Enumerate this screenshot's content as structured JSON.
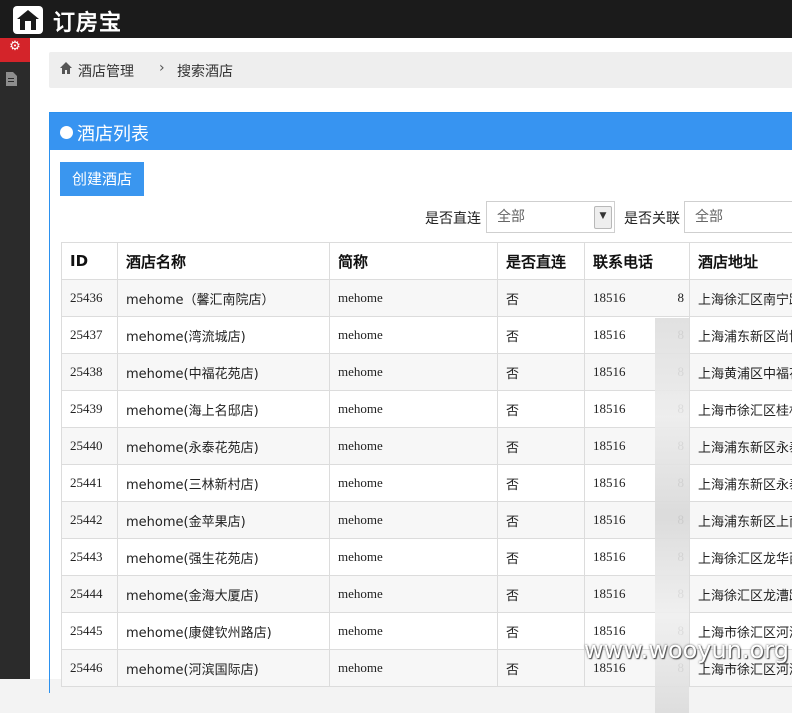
{
  "app": {
    "logo_text": "订房宝"
  },
  "breadcrumb": {
    "home": "酒店管理",
    "separator": "›",
    "current": "搜索酒店"
  },
  "panel": {
    "title": "酒店列表"
  },
  "toolbar": {
    "create_label": "创建酒店"
  },
  "filters": {
    "direct_label": "是否直连",
    "direct_value": "全部",
    "linked_label": "是否关联",
    "linked_value": "全部"
  },
  "table": {
    "headers": [
      "ID",
      "酒店名称",
      "简称",
      "是否直连",
      "联系电话",
      "酒店地址"
    ],
    "rows": [
      [
        "25436",
        "mehome（馨汇南院店）",
        "mehome",
        "否",
        "18516",
        "8",
        "上海徐汇区南宁路"
      ],
      [
        "25437",
        "mehome(湾流城店)",
        "mehome",
        "否",
        "18516",
        "8",
        "上海浦东新区尚博"
      ],
      [
        "25438",
        "mehome(中福花苑店)",
        "mehome",
        "否",
        "18516",
        "8",
        "上海黄浦区中福花"
      ],
      [
        "25439",
        "mehome(海上名邸店)",
        "mehome",
        "否",
        "18516",
        "8",
        "上海市徐汇区桂林"
      ],
      [
        "25440",
        "mehome(永泰花苑店)",
        "mehome",
        "否",
        "18516",
        "8",
        "上海浦东新区永泰"
      ],
      [
        "25441",
        "mehome(三林新村店)",
        "mehome",
        "否",
        "18516",
        "8",
        "上海浦东新区永泰"
      ],
      [
        "25442",
        "mehome(金苹果店)",
        "mehome",
        "否",
        "18516",
        "8",
        "上海浦东新区上南"
      ],
      [
        "25443",
        "mehome(强生花苑店)",
        "mehome",
        "否",
        "18516",
        "8",
        "上海徐汇区龙华西"
      ],
      [
        "25444",
        "mehome(金海大厦店)",
        "mehome",
        "否",
        "18516",
        "8",
        "上海徐汇区龙漕路"
      ],
      [
        "25445",
        "mehome(康健钦州路店)",
        "mehome",
        "否",
        "18516",
        "8",
        "上海市徐汇区河滨"
      ],
      [
        "25446",
        "mehome(河滨国际店)",
        "mehome",
        "否",
        "18516",
        "8",
        "上海市徐汇区河滨"
      ]
    ]
  },
  "watermark": "www.wooyun.org",
  "colors": {
    "accent": "#3794f1",
    "sidebar_active": "#d4242a",
    "topbar": "#1b1b1b"
  },
  "icons": [
    "home-icon",
    "gears-icon",
    "document-icon",
    "globe-icon",
    "chevron-down-icon"
  ]
}
